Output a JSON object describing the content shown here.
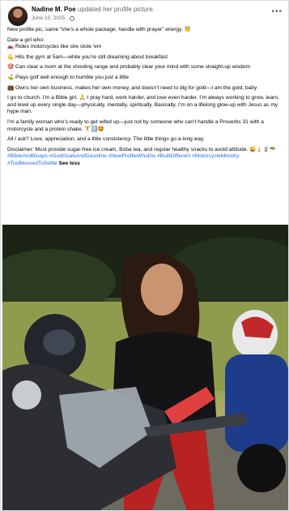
{
  "post": {
    "author": "Nadine M. Poe",
    "action": "updated her profile picture.",
    "date": "June 15, 2025 ·",
    "more": "•••"
  },
  "lines": [
    "New profile pic, same “she’s a whole package, handle with prayer” energy. 😇",
    "Date a girl who:",
    "🏍️ Rides motorcycles like she stole ’em",
    "💪 Hits the gym at 5am—while you’re still dreaming about breakfast",
    "🎯 Can clear a room at the shooting range and probably clear your mind with some straight-up wisdom",
    "⛳ Plays golf well enough to humble you just a little",
    "💼 Owns her own business, makes her own money, and doesn’t need to dig for gold—I am the gold, baby",
    "I go to church. I’m a Bible girl. 🙏 I pray hard, work harder, and love even harder. I’m always working to grow, learn, and level up every single day—physically, mentally, spiritually. Basically, I’m on a lifelong glow-up with Jesus as my hype man.",
    "I’m a family woman who’s ready to get wifed up—just not by someone who can’t handle a Proverbs 31 with a motorcycle and a protein shake. 🏋️🅿️🤩",
    "All I ask? Love, appreciation, and a little consistency. The little things go a long way.",
    "Disclaimer: Must provide sugar-free ice cream, Boba tea, and regular healthy snacks to avoid attitude. 😜🍦🧋🥗"
  ],
  "hashtags": "#BibleAndBiceps #GodGoalsAndGasoline #NewProfileWhoDis #BuiltDifferent #MotorcycleMinistry #TooBlessedToSettle",
  "see_less": "See less",
  "photo": {
    "subject": "woman-with-motorcycles-photo"
  }
}
